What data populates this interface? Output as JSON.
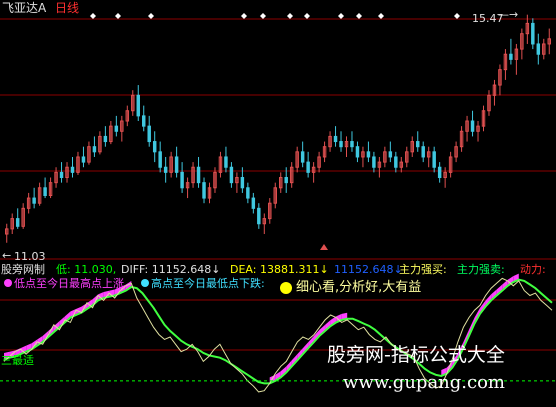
{
  "colors": {
    "background": "#000000",
    "grid": "#8b0000",
    "up_candle": "#e05050",
    "down_candle": "#40c8e0",
    "title": "#e0e0e0",
    "period": "#ff3030",
    "low_label": "#00ff00",
    "diff_label": "#e0e0e0",
    "dea_label": "#ffff00",
    "blue_label": "#2060ff",
    "buy_label": "#ffff60",
    "sell_label": "#00ff60",
    "power_label": "#ff3030",
    "magenta": "#ff40ff",
    "green_line": "#40ff40",
    "yellow_line": "#e0e0a0",
    "baseline": "#00ff00",
    "slogan": "#ffffa0",
    "watermark": "#ffffff",
    "marker_white": "#ffffff",
    "marker_cyan": "#00ffff"
  },
  "price_pane": {
    "stock_name": "飞亚达A",
    "period": "日线",
    "high_label": "15.47",
    "low_label": "11.03",
    "event_marker_count": 11
  },
  "indicator_pane": {
    "name": "股旁网制",
    "low": "低: 11.030,",
    "diff": "DIFF: 11152.648↓",
    "dea": "DEA: 13881.311↓",
    "blue_value": "11152.648↓",
    "main_buy": "主力强买:",
    "main_sell": "主力强卖:",
    "power": "动力:",
    "legend_left": "低点至今日最高点上涨",
    "legend_right": "高点至今日最低点下跌:",
    "slogan": "细心看,分析好,大有益",
    "baseline_label": "三最适"
  },
  "watermark": {
    "site_name": "股旁网-指标公式大全",
    "url": "www.gupang.com"
  },
  "chart_data": {
    "type": "candlestick",
    "ohlc": [
      [
        11.2,
        11.4,
        11.03,
        11.3
      ],
      [
        11.3,
        11.6,
        11.2,
        11.5
      ],
      [
        11.5,
        11.7,
        11.3,
        11.35
      ],
      [
        11.35,
        11.8,
        11.3,
        11.7
      ],
      [
        11.7,
        12.0,
        11.6,
        11.9
      ],
      [
        11.9,
        12.1,
        11.7,
        11.8
      ],
      [
        11.8,
        12.2,
        11.75,
        12.1
      ],
      [
        12.1,
        12.3,
        11.9,
        11.95
      ],
      [
        11.95,
        12.3,
        11.9,
        12.2
      ],
      [
        12.2,
        12.5,
        12.1,
        12.4
      ],
      [
        12.4,
        12.6,
        12.2,
        12.3
      ],
      [
        12.3,
        12.6,
        12.2,
        12.5
      ],
      [
        12.5,
        12.7,
        12.3,
        12.4
      ],
      [
        12.4,
        12.8,
        12.35,
        12.7
      ],
      [
        12.7,
        12.9,
        12.5,
        12.6
      ],
      [
        12.6,
        13.0,
        12.55,
        12.9
      ],
      [
        12.9,
        13.1,
        12.7,
        12.8
      ],
      [
        12.8,
        13.2,
        12.75,
        13.1
      ],
      [
        13.1,
        13.3,
        12.9,
        13.0
      ],
      [
        13.0,
        13.4,
        12.95,
        13.3
      ],
      [
        13.3,
        13.5,
        13.1,
        13.2
      ],
      [
        13.2,
        13.5,
        13.0,
        13.4
      ],
      [
        13.4,
        13.7,
        13.3,
        13.6
      ],
      [
        13.6,
        14.0,
        13.5,
        13.9
      ],
      [
        13.9,
        14.1,
        13.4,
        13.5
      ],
      [
        13.5,
        13.7,
        13.2,
        13.3
      ],
      [
        13.3,
        13.5,
        12.9,
        13.0
      ],
      [
        13.0,
        13.2,
        12.6,
        12.8
      ],
      [
        12.8,
        13.0,
        12.4,
        12.5
      ],
      [
        12.5,
        12.7,
        12.2,
        12.4
      ],
      [
        12.4,
        12.8,
        12.3,
        12.7
      ],
      [
        12.7,
        12.9,
        12.3,
        12.4
      ],
      [
        12.4,
        12.6,
        12.0,
        12.1
      ],
      [
        12.1,
        12.3,
        11.9,
        12.2
      ],
      [
        12.2,
        12.6,
        12.1,
        12.5
      ],
      [
        12.5,
        12.7,
        12.1,
        12.2
      ],
      [
        12.2,
        12.3,
        11.8,
        11.9
      ],
      [
        11.9,
        12.2,
        11.8,
        12.1
      ],
      [
        12.1,
        12.5,
        12.0,
        12.4
      ],
      [
        12.4,
        12.8,
        12.3,
        12.7
      ],
      [
        12.7,
        12.9,
        12.4,
        12.5
      ],
      [
        12.5,
        12.6,
        12.1,
        12.2
      ],
      [
        12.2,
        12.4,
        12.0,
        12.3
      ],
      [
        12.3,
        12.5,
        12.0,
        12.1
      ],
      [
        12.1,
        12.2,
        11.8,
        11.9
      ],
      [
        11.9,
        12.0,
        11.6,
        11.7
      ],
      [
        11.7,
        11.8,
        11.3,
        11.4
      ],
      [
        11.4,
        11.6,
        11.2,
        11.5
      ],
      [
        11.5,
        11.9,
        11.4,
        11.8
      ],
      [
        11.8,
        12.2,
        11.7,
        12.1
      ],
      [
        12.1,
        12.4,
        12.0,
        12.3
      ],
      [
        12.3,
        12.5,
        12.0,
        12.2
      ],
      [
        12.2,
        12.6,
        12.1,
        12.5
      ],
      [
        12.5,
        12.9,
        12.4,
        12.8
      ],
      [
        12.8,
        13.0,
        12.5,
        12.6
      ],
      [
        12.6,
        12.8,
        12.3,
        12.4
      ],
      [
        12.4,
        12.6,
        12.2,
        12.5
      ],
      [
        12.5,
        12.8,
        12.4,
        12.7
      ],
      [
        12.7,
        13.0,
        12.6,
        12.9
      ],
      [
        12.9,
        13.2,
        12.8,
        13.1
      ],
      [
        13.1,
        13.3,
        12.9,
        13.0
      ],
      [
        13.0,
        13.2,
        12.8,
        12.9
      ],
      [
        12.9,
        13.1,
        12.7,
        13.0
      ],
      [
        13.0,
        13.2,
        12.8,
        12.9
      ],
      [
        12.9,
        13.0,
        12.6,
        12.7
      ],
      [
        12.7,
        12.9,
        12.5,
        12.8
      ],
      [
        12.8,
        13.0,
        12.6,
        12.7
      ],
      [
        12.7,
        12.8,
        12.4,
        12.5
      ],
      [
        12.5,
        12.7,
        12.3,
        12.6
      ],
      [
        12.6,
        12.9,
        12.5,
        12.8
      ],
      [
        12.8,
        13.0,
        12.6,
        12.7
      ],
      [
        12.7,
        12.8,
        12.4,
        12.5
      ],
      [
        12.5,
        12.7,
        12.4,
        12.6
      ],
      [
        12.6,
        12.9,
        12.5,
        12.8
      ],
      [
        12.8,
        13.1,
        12.7,
        13.0
      ],
      [
        13.0,
        13.2,
        12.8,
        12.9
      ],
      [
        12.9,
        13.0,
        12.6,
        12.7
      ],
      [
        12.7,
        12.9,
        12.5,
        12.8
      ],
      [
        12.8,
        12.9,
        12.4,
        12.5
      ],
      [
        12.5,
        12.6,
        12.2,
        12.3
      ],
      [
        12.3,
        12.5,
        12.1,
        12.4
      ],
      [
        12.4,
        12.8,
        12.3,
        12.7
      ],
      [
        12.7,
        13.0,
        12.6,
        12.9
      ],
      [
        12.9,
        13.3,
        12.8,
        13.2
      ],
      [
        13.2,
        13.5,
        13.0,
        13.4
      ],
      [
        13.4,
        13.6,
        13.1,
        13.2
      ],
      [
        13.2,
        13.4,
        13.0,
        13.3
      ],
      [
        13.3,
        13.7,
        13.2,
        13.6
      ],
      [
        13.6,
        14.0,
        13.5,
        13.9
      ],
      [
        13.9,
        14.2,
        13.7,
        14.1
      ],
      [
        14.1,
        14.5,
        13.9,
        14.4
      ],
      [
        14.4,
        14.8,
        14.2,
        14.7
      ],
      [
        14.7,
        15.0,
        14.5,
        14.6
      ],
      [
        14.6,
        14.9,
        14.3,
        14.8
      ],
      [
        14.8,
        15.2,
        14.6,
        15.1
      ],
      [
        15.1,
        15.47,
        14.9,
        15.3
      ],
      [
        15.3,
        15.4,
        14.8,
        14.9
      ],
      [
        14.9,
        15.1,
        14.5,
        14.7
      ],
      [
        14.7,
        15.0,
        14.6,
        14.9
      ],
      [
        14.9,
        15.2,
        14.7,
        15.0
      ]
    ],
    "ylim": [
      10.85,
      15.6
    ],
    "indicator": {
      "green": [
        0.32,
        0.33,
        0.34,
        0.36,
        0.38,
        0.4,
        0.43,
        0.46,
        0.5,
        0.54,
        0.58,
        0.62,
        0.66,
        0.68,
        0.7,
        0.73,
        0.76,
        0.8,
        0.82,
        0.83,
        0.84,
        0.86,
        0.88,
        0.91,
        0.9,
        0.86,
        0.8,
        0.74,
        0.67,
        0.6,
        0.55,
        0.51,
        0.47,
        0.44,
        0.42,
        0.4,
        0.37,
        0.35,
        0.34,
        0.33,
        0.31,
        0.28,
        0.25,
        0.22,
        0.19,
        0.16,
        0.13,
        0.12,
        0.12,
        0.14,
        0.17,
        0.21,
        0.26,
        0.31,
        0.36,
        0.41,
        0.46,
        0.51,
        0.55,
        0.59,
        0.62,
        0.64,
        0.65,
        0.65,
        0.63,
        0.61,
        0.59,
        0.56,
        0.52,
        0.48,
        0.44,
        0.41,
        0.38,
        0.35,
        0.32,
        0.28,
        0.24,
        0.21,
        0.19,
        0.18,
        0.2,
        0.25,
        0.32,
        0.41,
        0.51,
        0.61,
        0.69,
        0.75,
        0.8,
        0.84,
        0.88,
        0.92,
        0.95,
        0.97,
        0.96,
        0.93,
        0.9,
        0.86,
        0.82,
        0.78
      ],
      "yellow": [
        0.3,
        0.34,
        0.38,
        0.4,
        0.36,
        0.4,
        0.46,
        0.44,
        0.52,
        0.6,
        0.56,
        0.64,
        0.62,
        0.72,
        0.7,
        0.78,
        0.74,
        0.84,
        0.8,
        0.86,
        0.82,
        0.88,
        0.92,
        0.94,
        0.82,
        0.74,
        0.66,
        0.58,
        0.52,
        0.48,
        0.5,
        0.44,
        0.38,
        0.4,
        0.44,
        0.38,
        0.3,
        0.34,
        0.4,
        0.44,
        0.36,
        0.28,
        0.24,
        0.2,
        0.14,
        0.1,
        0.05,
        0.06,
        0.12,
        0.2,
        0.26,
        0.3,
        0.38,
        0.46,
        0.5,
        0.48,
        0.52,
        0.58,
        0.64,
        0.68,
        0.66,
        0.62,
        0.64,
        0.6,
        0.56,
        0.58,
        0.52,
        0.48,
        0.46,
        0.5,
        0.44,
        0.4,
        0.38,
        0.36,
        0.34,
        0.24,
        0.16,
        0.12,
        0.08,
        0.1,
        0.2,
        0.32,
        0.46,
        0.58,
        0.66,
        0.72,
        0.76,
        0.84,
        0.9,
        0.94,
        0.98,
        0.96,
        0.92,
        0.96,
        0.88,
        0.84,
        0.86,
        0.8,
        0.76,
        0.72
      ],
      "baseline": 0.14,
      "ylim": [
        0,
        1
      ]
    }
  }
}
